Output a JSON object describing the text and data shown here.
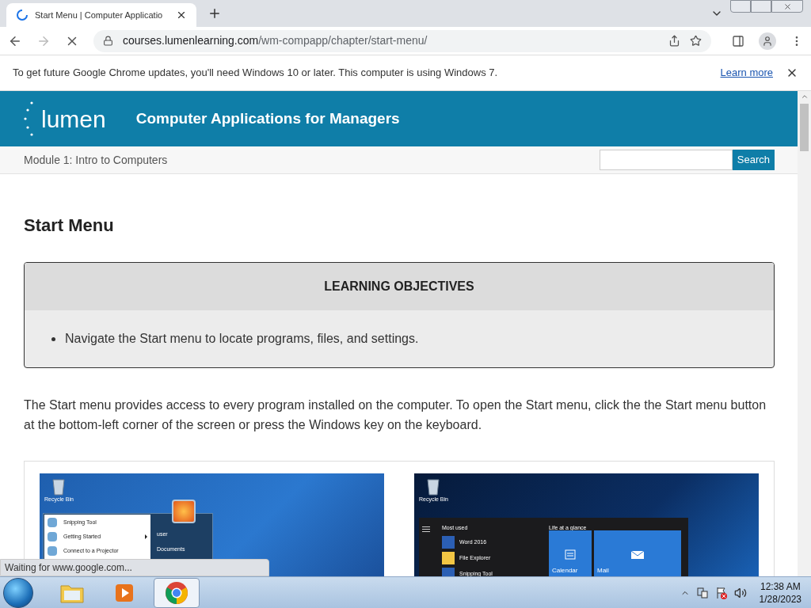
{
  "browser": {
    "tabs": [
      {
        "title": "Start Menu | Computer Applicatio",
        "loading": true,
        "selected": true
      }
    ],
    "address": {
      "domain": "courses.lumenlearning.com",
      "path": "/wm-compapp/chapter/start-menu/"
    },
    "loading": true,
    "infobar": {
      "message": "To get future Google Chrome updates, you'll need Windows 10 or later. This computer is using Windows 7.",
      "link": "Learn more"
    },
    "status": "Waiting for www.google.com..."
  },
  "site": {
    "logo": "lumen",
    "course_title": "Computer Applications for Managers",
    "breadcrumb": "Module 1: Intro to Computers",
    "search_button": "Search"
  },
  "article": {
    "title": "Start Menu",
    "objectives_heading": "LEARNING OBJECTIVES",
    "objectives": [
      "Navigate the Start menu to locate programs, files, and settings."
    ],
    "paragraph": "The Start menu provides access to every program installed on the computer. To open the Start menu, click the the Start menu button at the bottom-left corner of the screen or press the Windows key on the keyboard.",
    "figures": [
      {
        "kind": "win7",
        "desktop_icon": "Recycle Bin",
        "programs": [
          {
            "label": "Snipping Tool",
            "submenu": false
          },
          {
            "label": "Getting Started",
            "submenu": true
          },
          {
            "label": "Connect to a Projector",
            "submenu": false
          }
        ],
        "right_items": [
          "user",
          "Documents"
        ]
      },
      {
        "kind": "win10",
        "desktop_icon": "Recycle Bin",
        "most_used_heading": "Most used",
        "programs": [
          "Word 2016",
          "File Explorer",
          "Snipping Tool"
        ],
        "tiles_heading": "Life at a glance",
        "tiles": [
          "Calendar",
          "Mail"
        ]
      }
    ]
  },
  "taskbar": {
    "apps": [
      {
        "kind": "explorer",
        "selected": false
      },
      {
        "kind": "media",
        "selected": false
      },
      {
        "kind": "chrome",
        "selected": true
      }
    ],
    "time": "12:38 AM",
    "date": "1/28/2023"
  }
}
